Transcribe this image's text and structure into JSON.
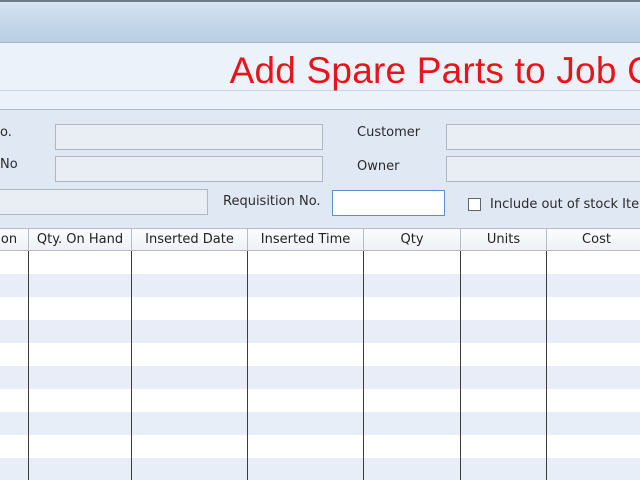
{
  "window": {
    "title": "Add Spare Parts to Job C"
  },
  "form": {
    "job_no_label": "o.",
    "vehicle_no_label": "No",
    "customer_label": "Customer",
    "owner_label": "Owner",
    "requisition_label": "Requisition No.",
    "requisition_value": "",
    "include_out_of_stock_label": "Include out of stock Iten",
    "include_out_of_stock_checked": false
  },
  "grid": {
    "columns": [
      "on",
      "Qty. On Hand",
      "Inserted Date",
      "Inserted Time",
      "Qty",
      "Units",
      "Cost"
    ],
    "row_count": 10,
    "rows": []
  },
  "colors": {
    "title": "#e8141b",
    "background": "#dfe8f3",
    "row_alt": "#e8eef7"
  }
}
